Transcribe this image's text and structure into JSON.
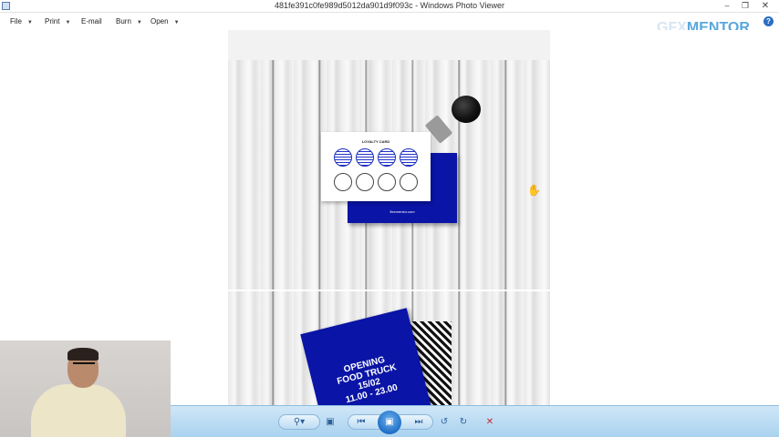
{
  "window": {
    "title": "481fe391c0fe989d5012da901d9f093c - Windows Photo Viewer",
    "minimize_icon": "minimize-icon",
    "maximize_icon": "restore-icon",
    "close_icon": "close-icon"
  },
  "menu": {
    "items": [
      {
        "label": "File",
        "has_dropdown": true
      },
      {
        "label": "Print",
        "has_dropdown": true
      },
      {
        "label": "E-mail",
        "has_dropdown": false
      },
      {
        "label": "Burn",
        "has_dropdown": true
      },
      {
        "label": "Open",
        "has_dropdown": true
      }
    ],
    "help_label": "?"
  },
  "watermark": {
    "part1": "GFX",
    "part2": "MENTOR"
  },
  "photo": {
    "loyalty_card_heading": "LOYALTY CARD",
    "blue_card_url": "flexmentor.com",
    "filled_stamps": 4,
    "empty_stamps": 4,
    "flyer_text": [
      "OPENING",
      "FOOD TRUCK",
      "15/02",
      "11.00 - 23.00"
    ],
    "brand_color": "#0a14a6"
  },
  "toolbar": {
    "zoom_icon": "magnifier-icon",
    "fit_icon": "actual-size-icon",
    "prev_icon": "previous-icon",
    "slideshow_icon": "slideshow-icon",
    "next_icon": "next-icon",
    "rotate_left_icon": "rotate-counterclockwise-icon",
    "rotate_right_icon": "rotate-clockwise-icon",
    "delete_icon": "delete-icon",
    "accent_color": "#1f6fc7"
  }
}
